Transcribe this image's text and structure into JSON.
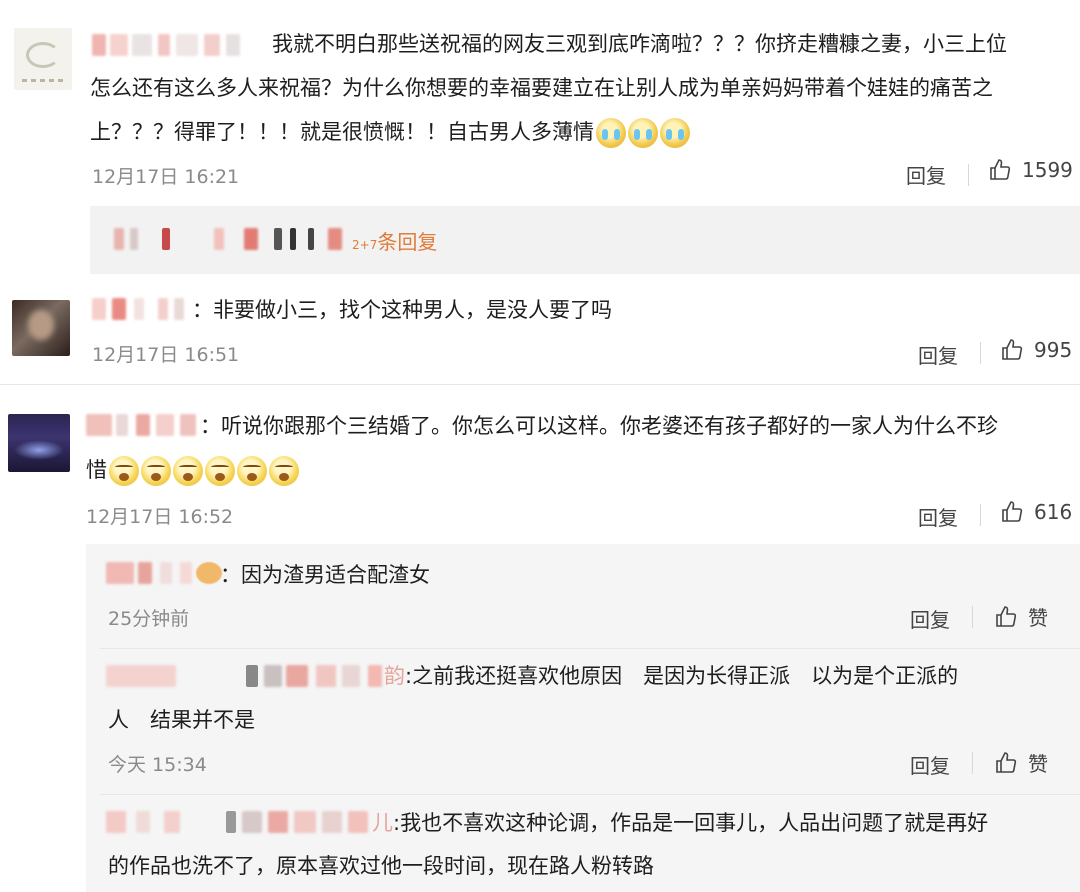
{
  "comments": [
    {
      "text_line1": "我就不明白那些送祝福的网友三观到底咋滴啦？？？你挤走糟糠之妻，小三上位",
      "text_line2": "怎么还有这么多人来祝福？为什么你想要的幸福要建立在让别人成为单亲妈妈带着个娃娃的痛苦之",
      "text_line3": "上？？？得罪了！！！就是很愤慨！！自古男人多薄情",
      "emoji": "crying-emoji",
      "time": "12月17日 16:21",
      "reply_label": "回复",
      "likes": "1599"
    },
    {
      "text": "非要做小三，找个这种男人，是没人要了吗",
      "time": "12月17日 16:51",
      "reply_label": "回复",
      "likes": "995"
    },
    {
      "text_line1": "听说你跟那个三结婚了。你怎么可以这样。你老婆还有孩子都好的一家人为什么不珍",
      "text_line2": "惜",
      "emoji": "yawning-emoji",
      "time": "12月17日 16:52",
      "reply_label": "回复",
      "likes": "616"
    }
  ],
  "reply_summary": {
    "text": "条回复",
    "prefix_num": "2+7"
  },
  "replies": [
    {
      "text": "：因为渣男适合配渣女",
      "time": "25分钟前",
      "reply_label": "回复",
      "like_label": "赞"
    },
    {
      "name_tail": "韵",
      "text_line1": ":之前我还挺喜欢他原因　是因为长得正派　以为是个正派的",
      "text_line2": "人　结果并不是",
      "time": "今天 15:34",
      "reply_label": "回复",
      "like_label": "赞"
    },
    {
      "name_tail": "儿",
      "text_line1": ":我也不喜欢这种论调，作品是一回事儿，人品出问题了就是再好",
      "text_line2": "的作品也洗不了，原本喜欢过他一段时间，现在路人粉转路"
    }
  ],
  "colors": {
    "accent": "#e07b39",
    "panel": "#f2f2f2",
    "time": "#8a8a8a"
  }
}
